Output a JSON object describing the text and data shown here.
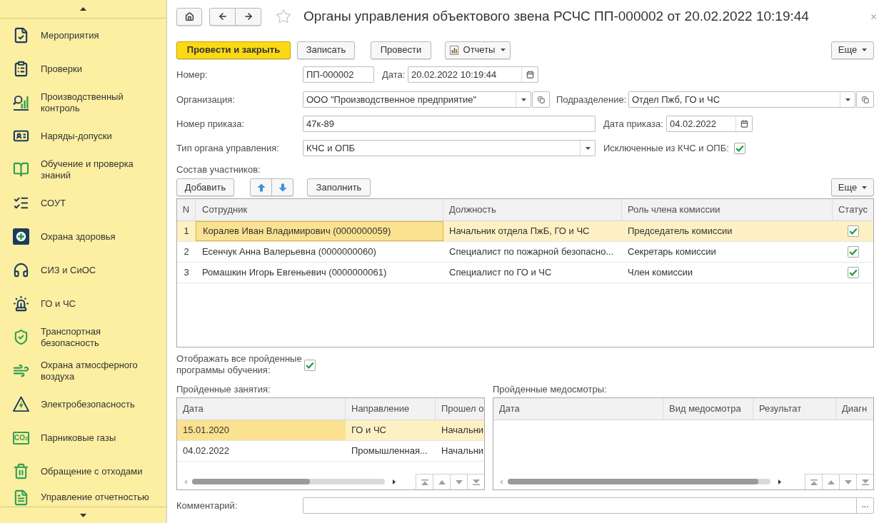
{
  "sidebar": {
    "items": [
      {
        "label": "Мероприятия"
      },
      {
        "label": "Проверки"
      },
      {
        "label": "Производственный контроль"
      },
      {
        "label": "Наряды-допуски"
      },
      {
        "label": "Обучение и проверка знаний"
      },
      {
        "label": "СОУТ"
      },
      {
        "label": "Охрана здоровья"
      },
      {
        "label": "СИЗ и СиОС"
      },
      {
        "label": "ГО и ЧС"
      },
      {
        "label": "Транспортная безопасность"
      },
      {
        "label": "Охрана атмосферного воздуха"
      },
      {
        "label": "Электробезопасность"
      },
      {
        "label": "Парниковые газы",
        "icon_text": "CO$_{2}$"
      },
      {
        "label": "Обращение с отходами"
      },
      {
        "label": "Управление отчетностью"
      }
    ]
  },
  "header": {
    "title": "Органы управления объектового звена РСЧС ПП-000002 от 20.02.2022 10:19:44",
    "favorite": false
  },
  "toolbar": {
    "buttons": [
      {
        "label": "Провести и закрыть",
        "kind": "primary"
      },
      {
        "label": "Записать",
        "kind": "plain"
      },
      {
        "label": "Провести",
        "kind": "plain"
      },
      {
        "label": "Отчеты",
        "kind": "menu"
      }
    ],
    "more": "Еще"
  },
  "form": {
    "number": {
      "label": "Номер:",
      "value": "ПП-000002"
    },
    "date": {
      "label": "Дата:",
      "value": "20.02.2022 10:19:44"
    },
    "organization": {
      "label": "Организация:",
      "value": "ООО \"Производственное предприятие\""
    },
    "department": {
      "label": "Подразделение:",
      "value": "Отдел Пжб, ГО и ЧС"
    },
    "order_number": {
      "label": "Номер приказа:",
      "value": "47к-89"
    },
    "order_date": {
      "label": "Дата приказа:",
      "value": "04.02.2022"
    },
    "body_type": {
      "label": "Тип органа управления:",
      "value": "КЧС и ОПБ"
    },
    "excluded": {
      "label": "Исключенные из КЧС и ОПБ:",
      "checked": true
    }
  },
  "participants": {
    "title": "Состав участников:",
    "add_button": "Добавить",
    "fill_button": "Заполнить",
    "more_button": "Еще",
    "focused": true,
    "columns": [
      "N",
      "Сотрудник",
      "Должность",
      "Роль члена комиссии",
      "Статус"
    ],
    "rows": [
      {
        "n": "1",
        "employee": "Коралев Иван Владимирович (0000000059)",
        "position": "Начальник отдела ПжБ, ГО и ЧС",
        "role": "Председатель комиссии",
        "status": true,
        "selected": true
      },
      {
        "n": "2",
        "employee": "Есенчук Анна Валерьевна (0000000060)",
        "position": "Специалист по пожарной безопасно...",
        "role": "Секретарь комиссии",
        "status": true,
        "selected": false
      },
      {
        "n": "3",
        "employee": "Ромашкин Игорь Евгеньевич (0000000061)",
        "position": "Специалист по ГО и ЧС",
        "role": "Член комиссии",
        "status": true,
        "selected": false
      }
    ]
  },
  "show_all_programs": {
    "label": "Отображать все пройденные программы обучения:",
    "checked": true
  },
  "lessons": {
    "title": "Пройденные занятия:",
    "columns": [
      "Дата",
      "Направление",
      "Прошел о"
    ],
    "rows": [
      {
        "date": "15.01.2020",
        "direction": "ГО и ЧС",
        "passed": "Начальни",
        "selected": true
      },
      {
        "date": "04.02.2022",
        "direction": "Промышленная...",
        "passed": "Начальни",
        "selected": false
      }
    ]
  },
  "medicals": {
    "title": "Пройденные медосмотры:",
    "columns": [
      "Дата",
      "Вид медосмотра",
      "Результат",
      "Диагн"
    ]
  },
  "comment": {
    "label": "Комментарий:",
    "button": "..."
  }
}
